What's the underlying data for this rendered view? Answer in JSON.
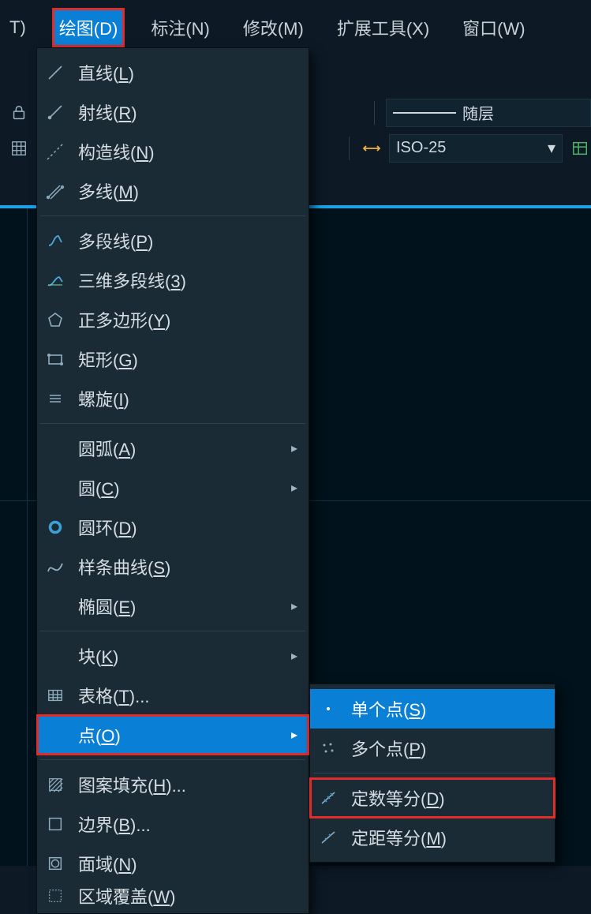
{
  "menubar": {
    "item_prev": "T)",
    "items": [
      "绘图(D)",
      "标注(N)",
      "修改(M)",
      "扩展工具(X)",
      "窗口(W)"
    ]
  },
  "toolbar": {
    "layer_label": "随层",
    "dimstyle": "ISO-25"
  },
  "dropdown": {
    "line": "直线",
    "line_u": "L",
    "ray": "射线",
    "ray_u": "R",
    "xline": "构造线",
    "xline_u": "N",
    "mline": "多线",
    "mline_u": "M",
    "pline": "多段线",
    "pline_u": "P",
    "p3d": "三维多段线",
    "p3d_u": "3",
    "poly": "正多边形",
    "poly_u": "Y",
    "rect": "矩形",
    "rect_u": "G",
    "helix": "螺旋",
    "helix_u": "I",
    "arc": "圆弧",
    "arc_u": "A",
    "circle": "圆",
    "circle_u": "C",
    "donut": "圆环",
    "donut_u": "D",
    "spline": "样条曲线",
    "spline_u": "S",
    "ellipse": "椭圆",
    "ellipse_u": "E",
    "block": "块",
    "block_u": "K",
    "table": "表格",
    "table_u": "T",
    "table_suffix": "...",
    "point": "点",
    "point_u": "O",
    "hatch": "图案填充",
    "hatch_u": "H",
    "hatch_suffix": "...",
    "boundary": "边界",
    "boundary_u": "B",
    "boundary_suffix": "...",
    "region": "面域",
    "region_u": "N",
    "revcloud": "区域覆盖",
    "revcloud_u": "W"
  },
  "submenu": {
    "single": "单个点",
    "single_u": "S",
    "multi": "多个点",
    "multi_u": "P",
    "divide": "定数等分",
    "divide_u": "D",
    "measure": "定距等分",
    "measure_u": "M"
  }
}
